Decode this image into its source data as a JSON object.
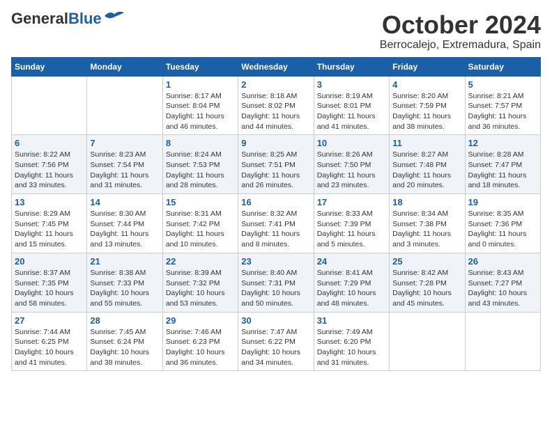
{
  "header": {
    "logo_general": "General",
    "logo_blue": "Blue",
    "title": "October 2024",
    "subtitle": "Berrocalejo, Extremadura, Spain"
  },
  "days_of_week": [
    "Sunday",
    "Monday",
    "Tuesday",
    "Wednesday",
    "Thursday",
    "Friday",
    "Saturday"
  ],
  "weeks": [
    [
      {
        "day": "",
        "info": ""
      },
      {
        "day": "",
        "info": ""
      },
      {
        "day": "1",
        "info": "Sunrise: 8:17 AM\nSunset: 8:04 PM\nDaylight: 11 hours and 46 minutes."
      },
      {
        "day": "2",
        "info": "Sunrise: 8:18 AM\nSunset: 8:02 PM\nDaylight: 11 hours and 44 minutes."
      },
      {
        "day": "3",
        "info": "Sunrise: 8:19 AM\nSunset: 8:01 PM\nDaylight: 11 hours and 41 minutes."
      },
      {
        "day": "4",
        "info": "Sunrise: 8:20 AM\nSunset: 7:59 PM\nDaylight: 11 hours and 38 minutes."
      },
      {
        "day": "5",
        "info": "Sunrise: 8:21 AM\nSunset: 7:57 PM\nDaylight: 11 hours and 36 minutes."
      }
    ],
    [
      {
        "day": "6",
        "info": "Sunrise: 8:22 AM\nSunset: 7:56 PM\nDaylight: 11 hours and 33 minutes."
      },
      {
        "day": "7",
        "info": "Sunrise: 8:23 AM\nSunset: 7:54 PM\nDaylight: 11 hours and 31 minutes."
      },
      {
        "day": "8",
        "info": "Sunrise: 8:24 AM\nSunset: 7:53 PM\nDaylight: 11 hours and 28 minutes."
      },
      {
        "day": "9",
        "info": "Sunrise: 8:25 AM\nSunset: 7:51 PM\nDaylight: 11 hours and 26 minutes."
      },
      {
        "day": "10",
        "info": "Sunrise: 8:26 AM\nSunset: 7:50 PM\nDaylight: 11 hours and 23 minutes."
      },
      {
        "day": "11",
        "info": "Sunrise: 8:27 AM\nSunset: 7:48 PM\nDaylight: 11 hours and 20 minutes."
      },
      {
        "day": "12",
        "info": "Sunrise: 8:28 AM\nSunset: 7:47 PM\nDaylight: 11 hours and 18 minutes."
      }
    ],
    [
      {
        "day": "13",
        "info": "Sunrise: 8:29 AM\nSunset: 7:45 PM\nDaylight: 11 hours and 15 minutes."
      },
      {
        "day": "14",
        "info": "Sunrise: 8:30 AM\nSunset: 7:44 PM\nDaylight: 11 hours and 13 minutes."
      },
      {
        "day": "15",
        "info": "Sunrise: 8:31 AM\nSunset: 7:42 PM\nDaylight: 11 hours and 10 minutes."
      },
      {
        "day": "16",
        "info": "Sunrise: 8:32 AM\nSunset: 7:41 PM\nDaylight: 11 hours and 8 minutes."
      },
      {
        "day": "17",
        "info": "Sunrise: 8:33 AM\nSunset: 7:39 PM\nDaylight: 11 hours and 5 minutes."
      },
      {
        "day": "18",
        "info": "Sunrise: 8:34 AM\nSunset: 7:38 PM\nDaylight: 11 hours and 3 minutes."
      },
      {
        "day": "19",
        "info": "Sunrise: 8:35 AM\nSunset: 7:36 PM\nDaylight: 11 hours and 0 minutes."
      }
    ],
    [
      {
        "day": "20",
        "info": "Sunrise: 8:37 AM\nSunset: 7:35 PM\nDaylight: 10 hours and 58 minutes."
      },
      {
        "day": "21",
        "info": "Sunrise: 8:38 AM\nSunset: 7:33 PM\nDaylight: 10 hours and 55 minutes."
      },
      {
        "day": "22",
        "info": "Sunrise: 8:39 AM\nSunset: 7:32 PM\nDaylight: 10 hours and 53 minutes."
      },
      {
        "day": "23",
        "info": "Sunrise: 8:40 AM\nSunset: 7:31 PM\nDaylight: 10 hours and 50 minutes."
      },
      {
        "day": "24",
        "info": "Sunrise: 8:41 AM\nSunset: 7:29 PM\nDaylight: 10 hours and 48 minutes."
      },
      {
        "day": "25",
        "info": "Sunrise: 8:42 AM\nSunset: 7:28 PM\nDaylight: 10 hours and 45 minutes."
      },
      {
        "day": "26",
        "info": "Sunrise: 8:43 AM\nSunset: 7:27 PM\nDaylight: 10 hours and 43 minutes."
      }
    ],
    [
      {
        "day": "27",
        "info": "Sunrise: 7:44 AM\nSunset: 6:25 PM\nDaylight: 10 hours and 41 minutes."
      },
      {
        "day": "28",
        "info": "Sunrise: 7:45 AM\nSunset: 6:24 PM\nDaylight: 10 hours and 38 minutes."
      },
      {
        "day": "29",
        "info": "Sunrise: 7:46 AM\nSunset: 6:23 PM\nDaylight: 10 hours and 36 minutes."
      },
      {
        "day": "30",
        "info": "Sunrise: 7:47 AM\nSunset: 6:22 PM\nDaylight: 10 hours and 34 minutes."
      },
      {
        "day": "31",
        "info": "Sunrise: 7:49 AM\nSunset: 6:20 PM\nDaylight: 10 hours and 31 minutes."
      },
      {
        "day": "",
        "info": ""
      },
      {
        "day": "",
        "info": ""
      }
    ]
  ]
}
